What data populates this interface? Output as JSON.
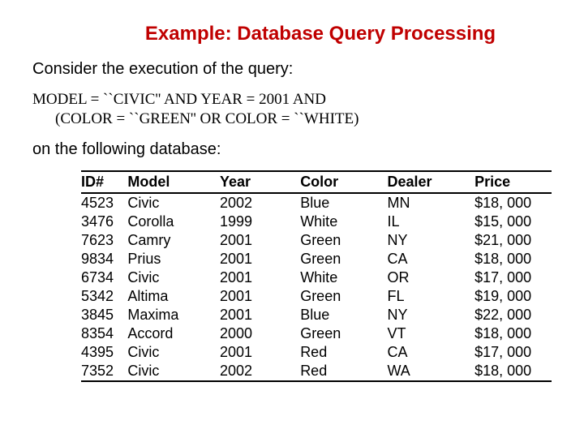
{
  "title": "Example: Database Query Processing",
  "intro": "Consider the execution of the query:",
  "query_line1": "MODEL = ``CIVIC'' AND YEAR = 2001 AND",
  "query_line2": "(COLOR = ``GREEN'' OR COLOR = ``WHITE)",
  "outro": "on the following database:",
  "headers": {
    "id": "ID#",
    "model": "Model",
    "year": "Year",
    "color": "Color",
    "dealer": "Dealer",
    "price": "Price"
  },
  "rows": [
    {
      "id": "4523",
      "model": "Civic",
      "year": "2002",
      "color": "Blue",
      "dealer": "MN",
      "price": "$18, 000"
    },
    {
      "id": "3476",
      "model": "Corolla",
      "year": "1999",
      "color": "White",
      "dealer": "IL",
      "price": "$15, 000"
    },
    {
      "id": "7623",
      "model": "Camry",
      "year": "2001",
      "color": "Green",
      "dealer": "NY",
      "price": "$21, 000"
    },
    {
      "id": "9834",
      "model": "Prius",
      "year": "2001",
      "color": "Green",
      "dealer": "CA",
      "price": "$18, 000"
    },
    {
      "id": "6734",
      "model": "Civic",
      "year": "2001",
      "color": "White",
      "dealer": "OR",
      "price": "$17, 000"
    },
    {
      "id": "5342",
      "model": "Altima",
      "year": "2001",
      "color": "Green",
      "dealer": "FL",
      "price": "$19, 000"
    },
    {
      "id": "3845",
      "model": "Maxima",
      "year": "2001",
      "color": "Blue",
      "dealer": "NY",
      "price": "$22, 000"
    },
    {
      "id": "8354",
      "model": "Accord",
      "year": "2000",
      "color": "Green",
      "dealer": "VT",
      "price": "$18, 000"
    },
    {
      "id": "4395",
      "model": "Civic",
      "year": "2001",
      "color": "Red",
      "dealer": "CA",
      "price": "$17, 000"
    },
    {
      "id": "7352",
      "model": "Civic",
      "year": "2002",
      "color": "Red",
      "dealer": "WA",
      "price": "$18, 000"
    }
  ]
}
